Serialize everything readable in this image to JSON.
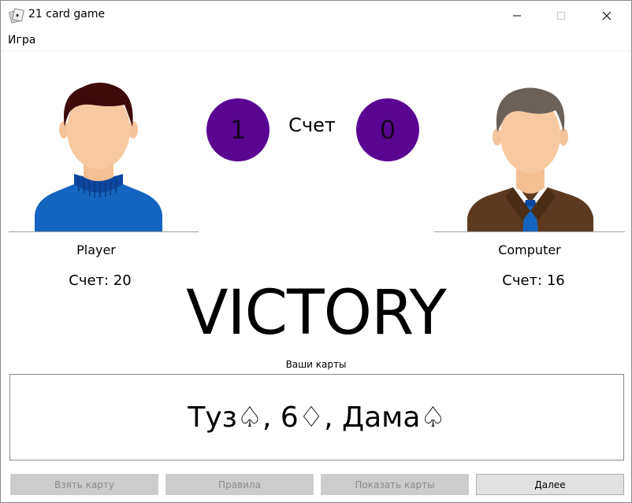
{
  "window": {
    "title": "21 card game",
    "controls": {
      "minimize": "minimize-icon",
      "maximize": "maximize-icon",
      "close": "close-icon"
    }
  },
  "menu": {
    "items": [
      "Игра"
    ]
  },
  "player": {
    "name": "Player",
    "points": "Счет: 20"
  },
  "computer": {
    "name": "Computer",
    "points": "Счет: 16"
  },
  "scoreboard": {
    "player_score": "1",
    "computer_score": "0",
    "label": "Счет"
  },
  "result": "VICTORY",
  "cards": {
    "caption": "Ваши карты",
    "text": "Туз♤, 6♢, Дама♤"
  },
  "buttons": {
    "take_card": "Взять карту",
    "rules": "Правила",
    "show_cards": "Показать карты",
    "next": "Далее"
  },
  "colors": {
    "score_circle": "#5a0592",
    "disabled_button": "#cccccc",
    "active_button": "#e1e1e1"
  }
}
